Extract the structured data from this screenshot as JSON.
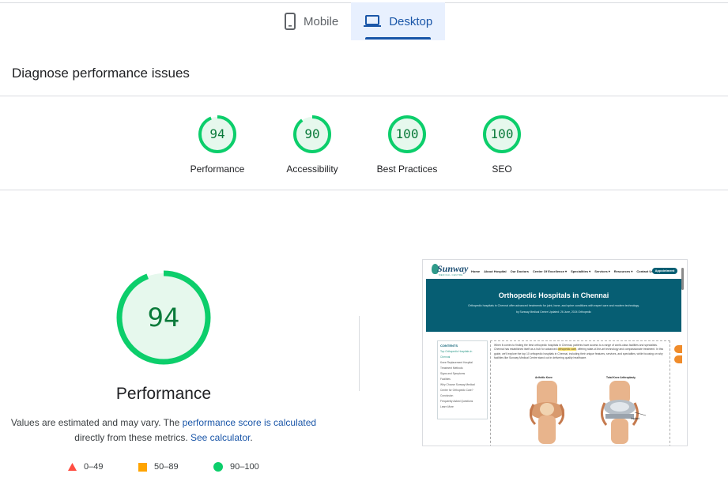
{
  "tabs": [
    {
      "label": "Mobile",
      "icon": "phone-icon",
      "active": false
    },
    {
      "label": "Desktop",
      "icon": "laptop-icon",
      "active": true
    }
  ],
  "diagnose_title": "Diagnose performance issues",
  "colors": {
    "pass": "#0cce6b",
    "pass_text": "#0a7a3a",
    "pass_bg": "#e6f8ed",
    "average": "#ffa400",
    "fail": "#ff4e42",
    "active_tab": "#1a56a8"
  },
  "categories": [
    {
      "label": "Performance",
      "score": "94",
      "score_value": 94
    },
    {
      "label": "Accessibility",
      "score": "90",
      "score_value": 90
    },
    {
      "label": "Best Practices",
      "score": "100",
      "score_value": 100
    },
    {
      "label": "SEO",
      "score": "100",
      "score_value": 100
    }
  ],
  "performance": {
    "score": "94",
    "score_value": 94,
    "title": "Performance",
    "note_prefix": "Values are estimated and may vary. The ",
    "note_link1": "performance score is calculated",
    "note_middle": "directly from these metrics. ",
    "note_link2": "See calculator",
    "note_suffix": "."
  },
  "legend": [
    {
      "shape": "triangle",
      "range": "0–49"
    },
    {
      "shape": "square",
      "range": "50–89"
    },
    {
      "shape": "circle",
      "range": "90–100"
    }
  ],
  "screenshot": {
    "logo": "Sunway",
    "logo_sub": "MEDICAL CENTRE",
    "nav": [
      "Home",
      "About Hospital",
      "Our Doctors",
      "Center Of Excellence ▾",
      "Specialities ▾",
      "Services ▾",
      "Resources ▾",
      "Contact Us"
    ],
    "appointment": "Appointment",
    "hero_title": "Orthopedic Hospitals in Chennai",
    "hero_text": "Orthopedic hospitals in Chennai offer advanced treatments for joint, bone, and spine conditions with expert care and modern technology.",
    "hero_meta": "by Sunway Medical Centre     Updated: 26 June, 2024     Orthopedic",
    "toc_head": "CONTENTS",
    "toc_items": [
      "Top Orthopedic Hospitals in",
      "Chennai",
      "Knee Replacement Hospital",
      "Treatment Methods",
      "Signs and Symptoms",
      "Facilities",
      "Why Choose Sunway Medical",
      "Centre for Orthopedic Care?",
      "Conclusion",
      "Frequently Asked Questions",
      "Learn More"
    ],
    "para_a": "When it comes to finding the best orthopedic hospitals in Chennai, patients have access to a range of world-class facilities and specialists. Chennai has established itself as a hub for advanced ",
    "para_hl": "orthopedic care",
    "para_b": ", offering state-of-the-art technology and compassionate treatment. In this guide, we'll explore the top 10 orthopedic hospitals in Chennai, including their unique features, services, and specialties, while focusing on why facilities like Sunway Medical Centre stand out in delivering quality healthcare.",
    "knee_left": "Arthritic Knee",
    "knee_right": "Total Knee Arthroplasty",
    "implant": "Implant"
  }
}
